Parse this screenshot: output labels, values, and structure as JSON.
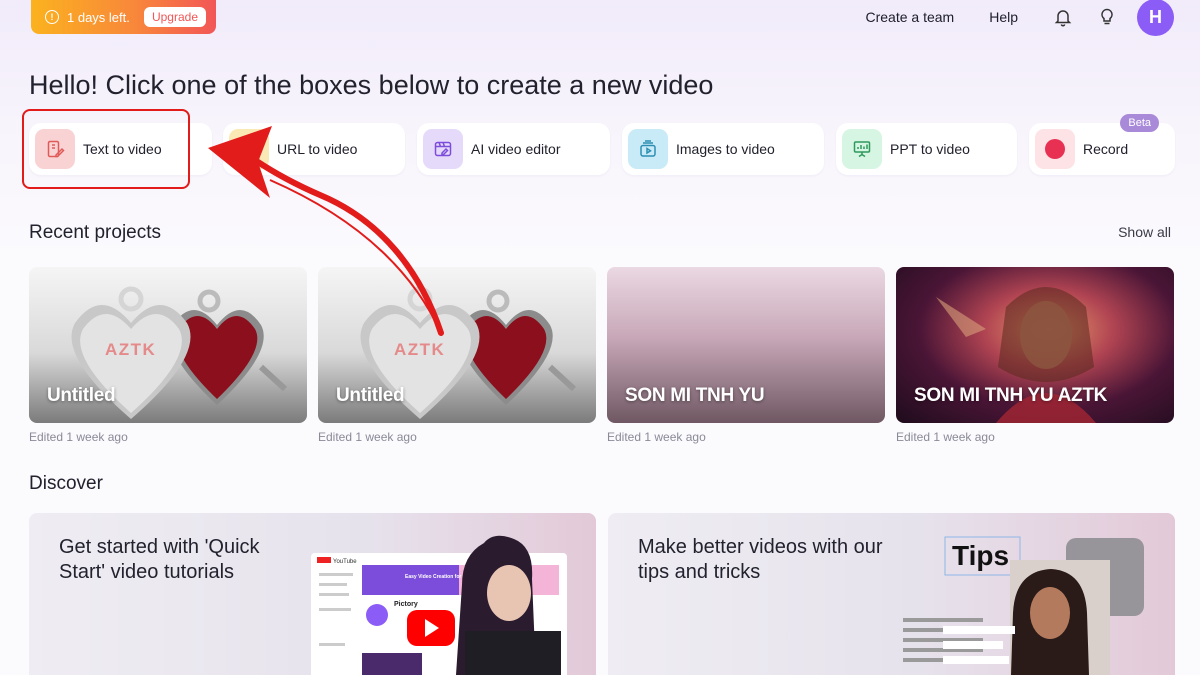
{
  "banner": {
    "trial_text": "1 days left.",
    "upgrade_label": "Upgrade"
  },
  "topnav": {
    "create_team": "Create a team",
    "help": "Help",
    "avatar_initial": "H"
  },
  "headline": "Hello! Click one of the boxes below to create a new video",
  "tiles": [
    {
      "label": "Text to video",
      "icon": "text-edit-icon",
      "color": "#f9d3d3"
    },
    {
      "label": "URL to video",
      "icon": "link-icon",
      "color": "#fbe9b5"
    },
    {
      "label": "AI video editor",
      "icon": "video-edit-icon",
      "color": "#e6dafb"
    },
    {
      "label": "Images to video",
      "icon": "images-icon",
      "color": "#c8ebf7"
    },
    {
      "label": "PPT to video",
      "icon": "presentation-icon",
      "color": "#d6f5e2"
    },
    {
      "label": "Record",
      "icon": "record-icon",
      "color": "#fde2e6",
      "badge": "Beta"
    }
  ],
  "recent": {
    "title": "Recent projects",
    "show_all": "Show all",
    "projects": [
      {
        "title": "Untitled",
        "edited": "Edited 1 week ago",
        "thumb": "hearts"
      },
      {
        "title": "Untitled",
        "edited": "Edited 1 week ago",
        "thumb": "hearts"
      },
      {
        "title": "SON MI TNH YU",
        "edited": "Edited 1 week ago",
        "thumb": "gradient"
      },
      {
        "title": "SON MI TNH YU AZTK",
        "edited": "Edited 1 week ago",
        "thumb": "portrait"
      }
    ],
    "thumb_logo": "AZTK"
  },
  "discover": {
    "title": "Discover",
    "cards": [
      {
        "text": "Get started with 'Quick Start' video tutorials",
        "preview_logo": "YouTube",
        "preview_headline": "Easy Video Creation for Content Marketers",
        "preview_name": "Pictory"
      },
      {
        "text": "Make better videos with our tips and tricks",
        "preview_label": "Tips"
      }
    ]
  },
  "colors": {
    "accent": "#8b5cf6",
    "highlight": "#e21b1b",
    "banner": "#f8883a"
  }
}
